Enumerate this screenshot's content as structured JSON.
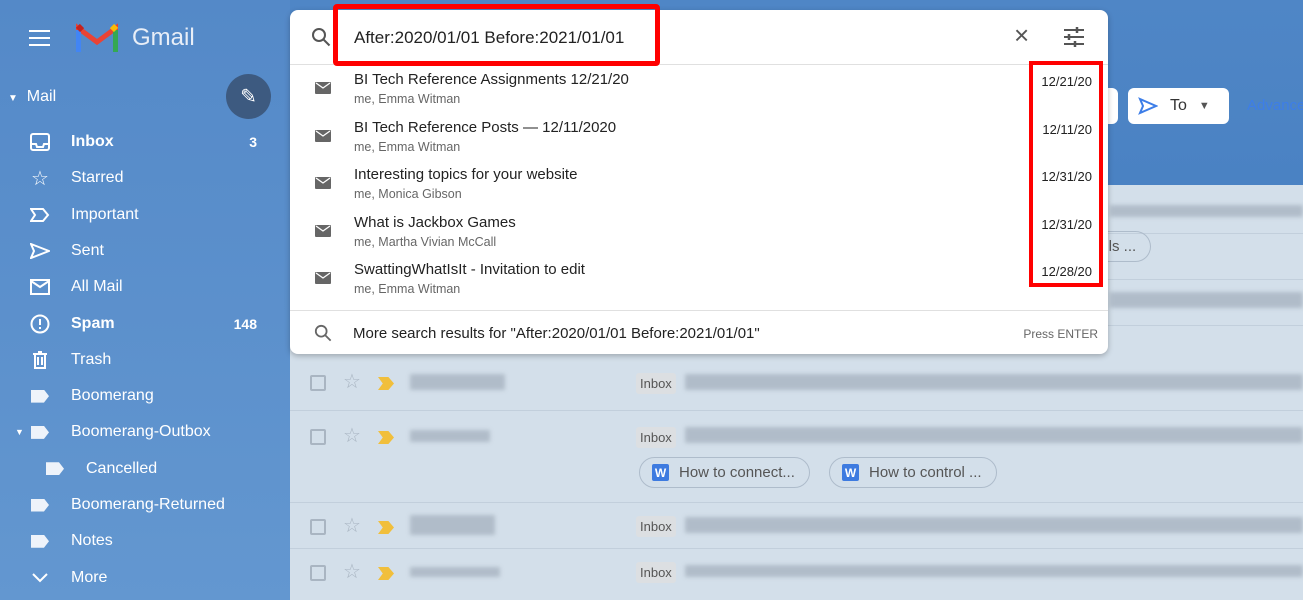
{
  "app": {
    "name": "Gmail"
  },
  "sidebar": {
    "section": "Mail",
    "items": [
      {
        "label": "Inbox",
        "count": "3",
        "icon": "inbox-icon",
        "bold": true
      },
      {
        "label": "Starred",
        "icon": "star-icon"
      },
      {
        "label": "Important",
        "icon": "important-icon"
      },
      {
        "label": "Sent",
        "icon": "send-icon"
      },
      {
        "label": "All Mail",
        "icon": "mail-icon"
      },
      {
        "label": "Spam",
        "count": "148",
        "icon": "spam-icon",
        "bold": true
      },
      {
        "label": "Trash",
        "icon": "trash-icon"
      },
      {
        "label": "Boomerang",
        "icon": "label-icon"
      },
      {
        "label": "Boomerang-Outbox",
        "icon": "label-icon"
      },
      {
        "label": "Cancelled",
        "icon": "label-icon"
      },
      {
        "label": "Boomerang-Returned",
        "icon": "label-icon"
      },
      {
        "label": "Notes",
        "icon": "label-icon"
      },
      {
        "label": "More",
        "icon": "chevron-down-icon"
      }
    ]
  },
  "search": {
    "query": "After:2020/01/01 Before:2021/01/01",
    "suggestions": [
      {
        "title": "BI Tech Reference Assignments 12/21/20",
        "participants": "me, Emma Witman",
        "date": "12/21/20"
      },
      {
        "title": "BI Tech Reference Posts — 12/11/2020",
        "participants": "me, Emma Witman",
        "date": "12/11/20"
      },
      {
        "title": "Interesting topics for your website",
        "participants": "me, Monica Gibson",
        "date": "12/31/20"
      },
      {
        "title": "What is Jackbox Games",
        "participants": "me, Martha Vivian McCall",
        "date": "12/31/20"
      },
      {
        "title": "SwattingWhatIsIt - Invitation to edit",
        "participants": "me, Emma Witman",
        "date": "12/28/20"
      }
    ],
    "more": "More search results for \"After:2020/01/01 Before:2021/01/01\"",
    "hint": "Press ENTER"
  },
  "filters": {
    "to": "To",
    "advanced": "Advanced search"
  },
  "list": {
    "label": "Inbox",
    "chips": [
      "How to connect...",
      "How to control ...",
      "s & Fails ..."
    ]
  },
  "colors": {
    "highlight": "#ff0000",
    "sidebar": "#5a8fcb"
  }
}
